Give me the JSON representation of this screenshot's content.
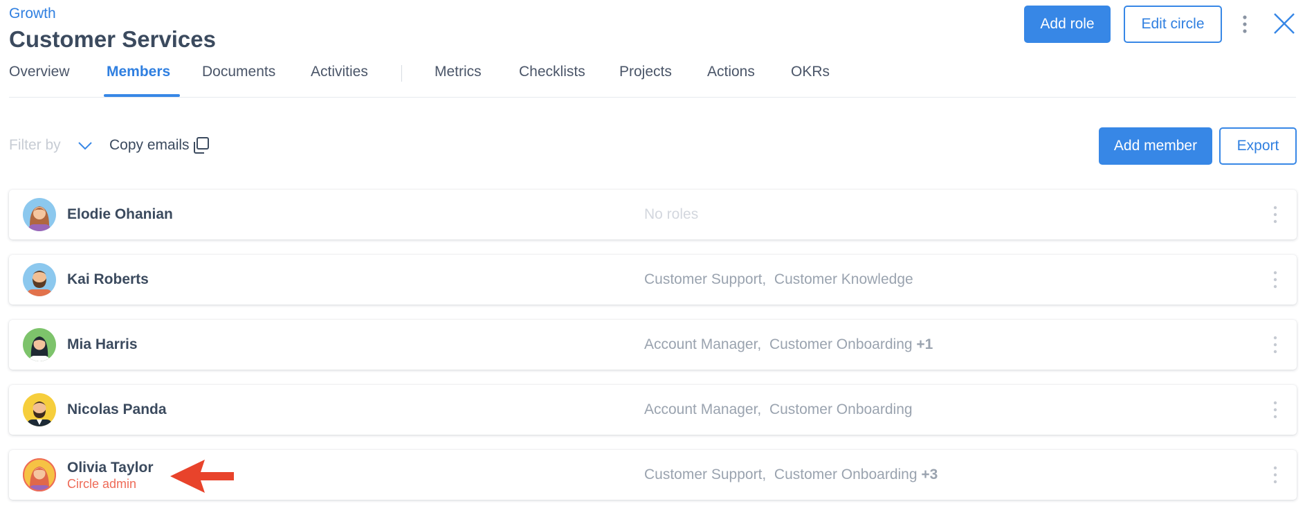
{
  "header": {
    "breadcrumb": "Growth",
    "title": "Customer Services",
    "add_role_label": "Add role",
    "edit_circle_label": "Edit circle"
  },
  "tabs": [
    {
      "label": "Overview",
      "active": false
    },
    {
      "label": "Members",
      "active": true
    },
    {
      "label": "Documents",
      "active": false
    },
    {
      "label": "Activities",
      "active": false
    },
    {
      "label": "Metrics",
      "active": false
    },
    {
      "label": "Checklists",
      "active": false
    },
    {
      "label": "Projects",
      "active": false
    },
    {
      "label": "Actions",
      "active": false
    },
    {
      "label": "OKRs",
      "active": false
    }
  ],
  "toolbar": {
    "filter_placeholder": "Filter by",
    "copy_emails_label": "Copy emails",
    "add_member_label": "Add member",
    "export_label": "Export"
  },
  "members": [
    {
      "name": "Elodie Ohanian",
      "subtitle": "",
      "roles": [
        "No roles"
      ],
      "more": "",
      "avatar": "woman-brown-hair-avatar"
    },
    {
      "name": "Kai Roberts",
      "subtitle": "",
      "roles": [
        "Customer Support,",
        "Customer Knowledge"
      ],
      "more": "",
      "avatar": "bearded-man-avatar"
    },
    {
      "name": "Mia Harris",
      "subtitle": "",
      "roles": [
        "Account Manager,",
        "Customer Onboarding"
      ],
      "more": "+1",
      "avatar": "woman-black-hair-avatar"
    },
    {
      "name": "Nicolas Panda",
      "subtitle": "",
      "roles": [
        "Account Manager,",
        "Customer Onboarding"
      ],
      "more": "",
      "avatar": "man-beard-suit-avatar"
    },
    {
      "name": "Olivia Taylor",
      "subtitle": "Circle admin",
      "roles": [
        "Customer Support,",
        "Customer Onboarding"
      ],
      "more": "+3",
      "avatar": "woman-red-hair-avatar"
    }
  ],
  "colors": {
    "accent": "#3787e6",
    "admin_label": "#ee6a57",
    "annotation_arrow": "#e8432b"
  }
}
